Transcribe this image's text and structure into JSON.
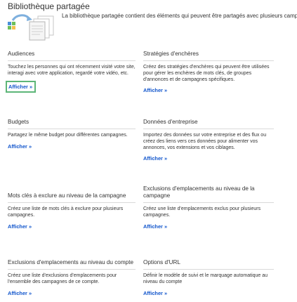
{
  "header": {
    "title": "Bibliothèque partagée",
    "intro": "La bibliothèque partagée contient des éléments qui peuvent être partagés avec plusieurs campagnes ou group"
  },
  "cards": [
    {
      "title": "Audiences",
      "description": "Touchez les personnes qui ont récemment visité votre site, interagi avec votre application, regardé votre vidéo, etc.",
      "link_label": "Afficher »"
    },
    {
      "title": "Stratégies d'enchères",
      "description": "Créez des stratégies d'enchères qui peuvent être utilisées pour gérer les enchères de mots clés, de groupes d'annonces et de campagnes spécifiques.",
      "link_label": "Afficher »"
    },
    {
      "title": "Budgets",
      "description": "Partagez le même budget pour différentes campagnes.",
      "link_label": "Afficher »"
    },
    {
      "title": "Données d'entreprise",
      "description": "Importez des données sur votre entreprise et des flux ou créez des liens vers ces données pour alimenter vos annonces, vos extensions et vos ciblages.",
      "link_label": "Afficher »"
    },
    {
      "title": "Mots clés à exclure au niveau de la campagne",
      "description": "Créez une liste de mots clés à exclure pour plusieurs campagnes.",
      "link_label": "Afficher »"
    },
    {
      "title": "Exclusions d'emplacements au niveau de la campagne",
      "description": "Créez une liste d'emplacements exclus pour plusieurs campagnes.",
      "link_label": "Afficher »"
    },
    {
      "title": "Exclusions d'emplacements au niveau du compte",
      "description": "Créez une liste d'exclusions d'emplacements pour l'ensemble des campagnes de ce compte.",
      "link_label": "Afficher »"
    },
    {
      "title": "Options d'URL",
      "description": "Définir le modèle de suivi et le marquage automatique au niveau du compte",
      "link_label": "Afficher »"
    }
  ],
  "colors": {
    "link": "#1155cc",
    "highlight_border": "#5db678",
    "divider": "#d9d9d9"
  }
}
